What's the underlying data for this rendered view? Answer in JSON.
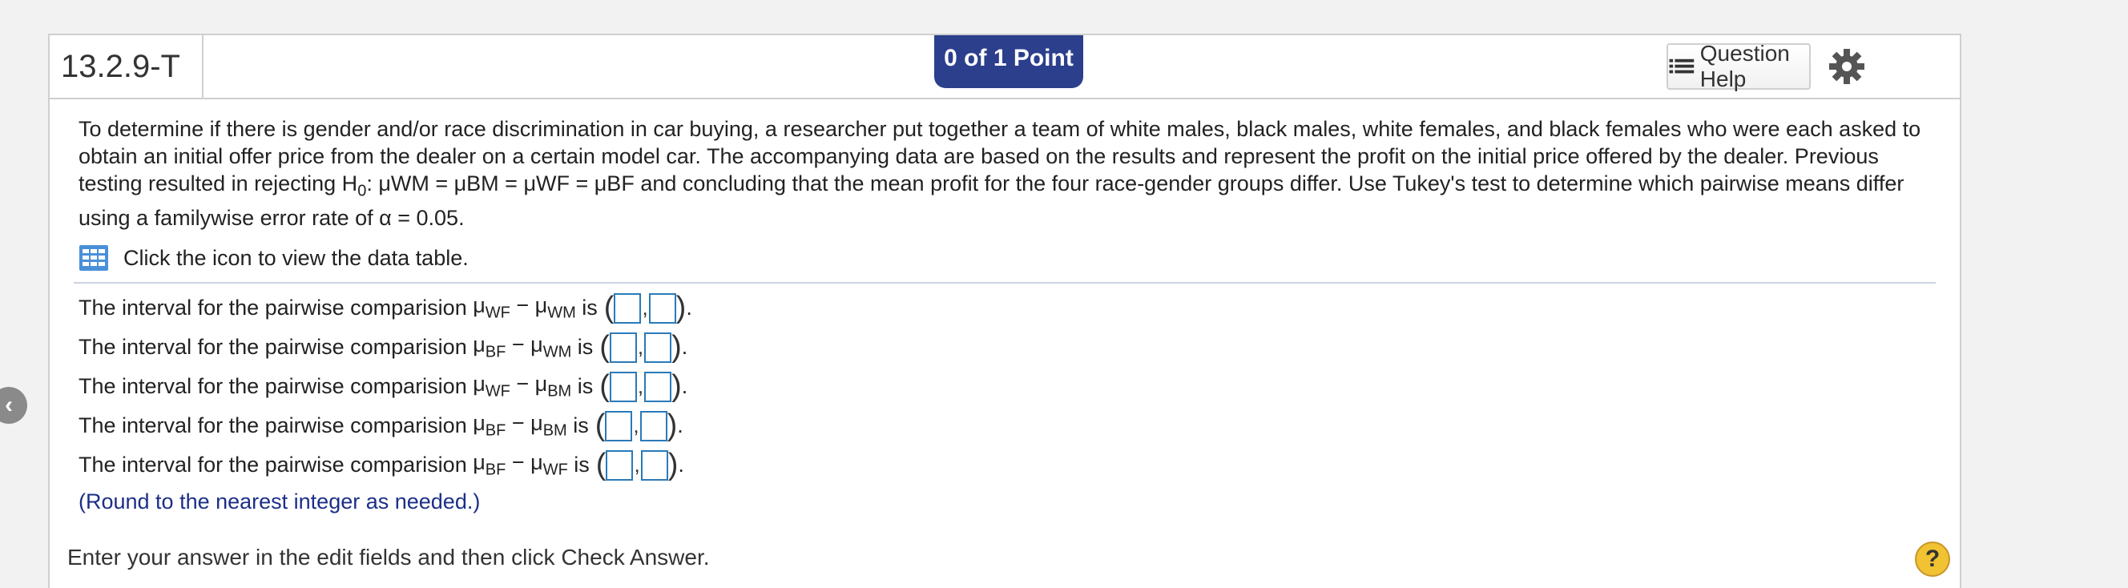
{
  "header": {
    "question_id": "13.2.9-T",
    "points": "0 of 1 Point",
    "help_label": "Question Help"
  },
  "problem": {
    "text_before_hyp": "To determine if there is gender and/or race discrimination in car buying, a researcher put together a team of white males, black males, white females, and black females who were each asked to obtain an initial offer price from the dealer on a certain model car. The accompanying data are based on the results and represent the profit on the initial price offered by the dealer. Previous testing resulted in rejecting H",
    "hyp_sub": "0",
    "hyp_body": ": μWM = μBM = μWF = μBF",
    "text_after_hyp": " and concluding that the mean profit for the four race-gender groups differ. Use Tukey's test to determine which pairwise means differ using a familywise error rate of α = 0.05.",
    "data_link": "Click the icon to view the data table."
  },
  "answers": [
    {
      "prefix": "The interval for the pairwise comparision",
      "mu1": "WF",
      "mu2": "WM",
      "suffix": "is"
    },
    {
      "prefix": "The interval for the pairwise comparision",
      "mu1": "BF",
      "mu2": "WM",
      "suffix": "is"
    },
    {
      "prefix": "The interval for the pairwise comparision",
      "mu1": "WF",
      "mu2": "BM",
      "suffix": "is"
    },
    {
      "prefix": "The interval for the pairwise comparision",
      "mu1": "BF",
      "mu2": "BM",
      "suffix": "is"
    },
    {
      "prefix": "The interval for the pairwise comparision",
      "mu1": "BF",
      "mu2": "WF",
      "suffix": "is"
    }
  ],
  "note": "(Round to the nearest integer as needed.)",
  "footer": "Enter your answer in the edit fields and then click Check Answer.",
  "colors": {
    "points_badge": "#2b3f8c",
    "note_text": "#1c2f87",
    "input_border": "#2a7ab8",
    "help_circle": "#f1c232"
  },
  "icons": [
    "back-arrow-icon",
    "list-icon",
    "gear-icon",
    "table-icon",
    "help-circle-icon"
  ]
}
